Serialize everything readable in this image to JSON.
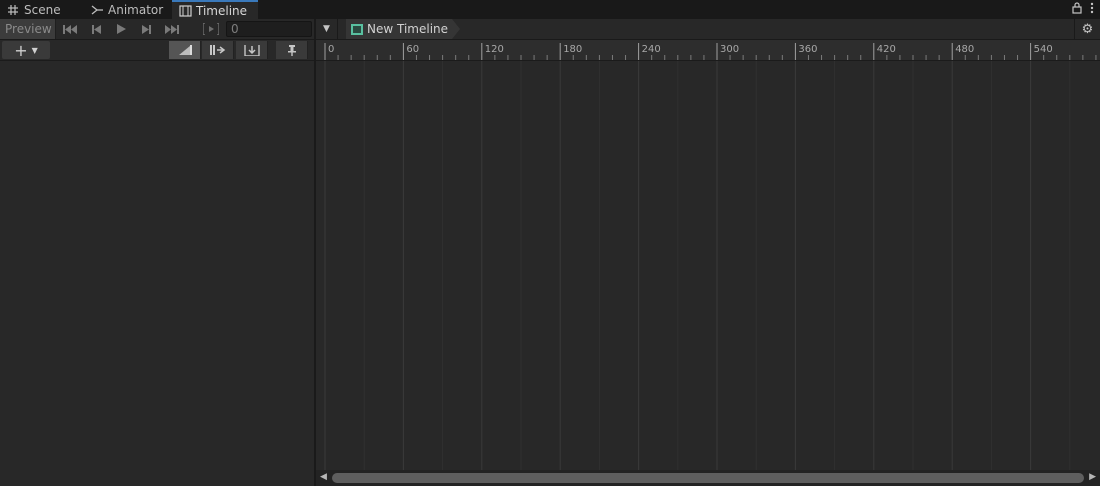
{
  "tabs": [
    {
      "label": "Scene",
      "icon": "grid-icon"
    },
    {
      "label": "Animator",
      "icon": "branch-icon"
    },
    {
      "label": "Timeline",
      "icon": "film-icon",
      "active": true
    }
  ],
  "toolbar": {
    "preview_label": "Preview",
    "frame_value": "0"
  },
  "timeline": {
    "asset_name": "New Timeline"
  },
  "ruler": {
    "labels": [
      "0",
      "60",
      "120",
      "180",
      "240",
      "300",
      "360",
      "420",
      "480",
      "540"
    ]
  },
  "colors": {
    "accent": "#3a79bb",
    "timeline_icon": "#59c0a0",
    "background": "#282828"
  }
}
